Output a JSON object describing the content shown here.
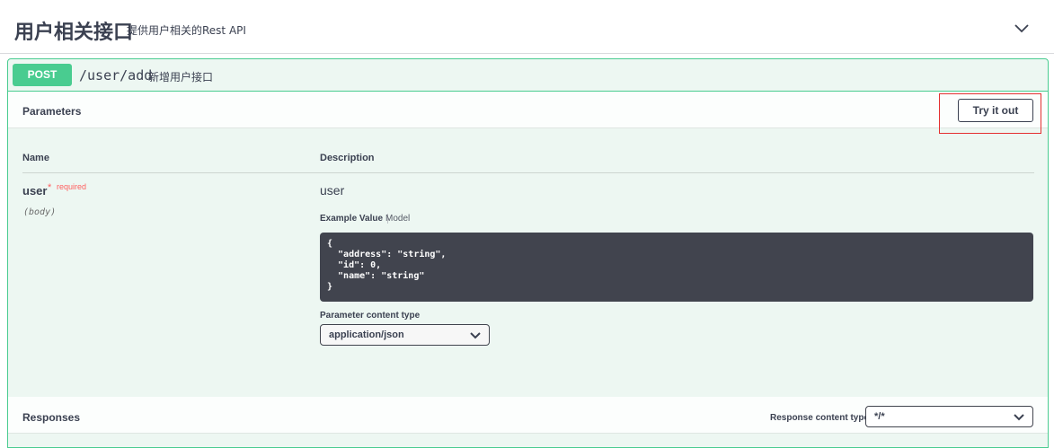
{
  "tag": {
    "title": "用户相关接口",
    "description": "提供用户相关的Rest API",
    "collapse_icon": "chevron-down-icon"
  },
  "operation": {
    "method": "POST",
    "path": "/user/add",
    "summary": "新增用户接口",
    "color": "#49cc90"
  },
  "parameters": {
    "title": "Parameters",
    "try_out_label": "Try it out",
    "columns": {
      "name": "Name",
      "description": "Description"
    },
    "items": [
      {
        "name": "user",
        "required_star": "*",
        "required_label": "required",
        "in": "(body)",
        "description": "user",
        "tabs": {
          "example": "Example Value",
          "model": "Model"
        },
        "example_lines": [
          "{",
          "  \"address\": \"string\",",
          "  \"id\": 0,",
          "  \"name\": \"string\"",
          "}"
        ],
        "content_type_label": "Parameter content type",
        "content_type_value": "application/json"
      }
    ]
  },
  "responses": {
    "title": "Responses",
    "content_type_label": "Response content type",
    "content_type_value": "*/*"
  }
}
